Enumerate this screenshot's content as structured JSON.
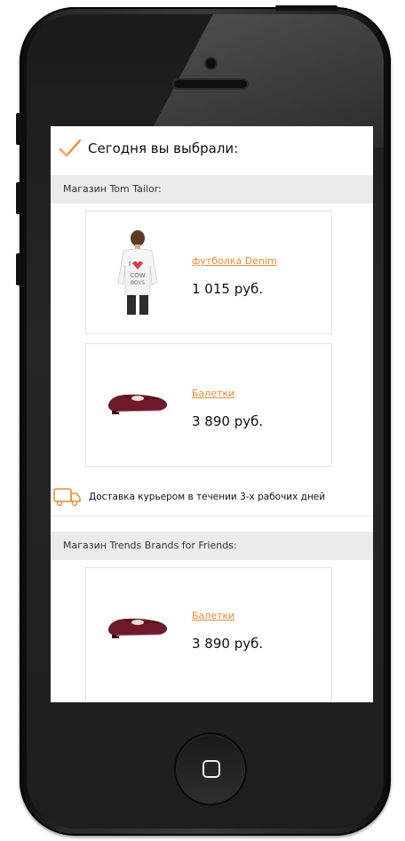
{
  "header": {
    "title": "Сегодня вы выбрали:"
  },
  "stores": [
    {
      "label": "Магазин Tom Tailor:",
      "products": [
        {
          "name": "футболка Denim",
          "price": "1 015 руб.",
          "image": "tshirt-image"
        },
        {
          "name": "Балетки",
          "price": "3 890 руб.",
          "image": "ballet-flat-image"
        }
      ],
      "delivery": "Доставка курьером в течении 3-х рабочих дней"
    },
    {
      "label": "Магазин Trends Brands for Friends:",
      "products": [
        {
          "name": "Балетки",
          "price": "3 890 руб.",
          "image": "ballet-flat-image"
        }
      ]
    }
  ],
  "colors": {
    "accent": "#e88a34",
    "store_bar": "#ebebeb",
    "shoe": "#6e1a2a"
  },
  "icons": [
    "checkmark-icon",
    "truck-icon",
    "home-square-icon"
  ]
}
